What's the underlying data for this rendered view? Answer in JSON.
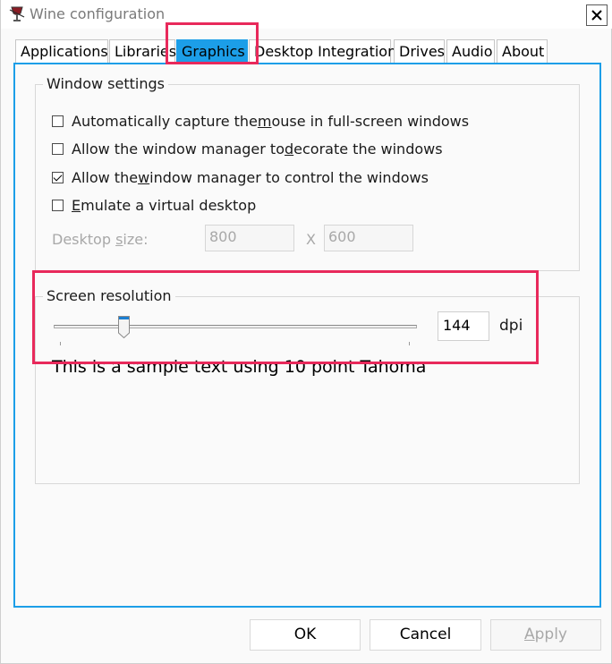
{
  "window": {
    "title": "Wine configuration",
    "close_label": "×"
  },
  "tabs": [
    {
      "label": "Applications"
    },
    {
      "label": "Libraries"
    },
    {
      "label": "Graphics",
      "active": true
    },
    {
      "label": "Desktop Integration"
    },
    {
      "label": "Drives"
    },
    {
      "label": "Audio"
    },
    {
      "label": "About"
    }
  ],
  "window_settings": {
    "legend": "Window settings",
    "options": [
      {
        "pre": "Automatically capture the ",
        "accel": "m",
        "post": "ouse in full-screen windows",
        "checked": false
      },
      {
        "pre": "Allow the window manager to ",
        "accel": "d",
        "post": "ecorate the windows",
        "checked": false
      },
      {
        "pre": "Allow the ",
        "accel": "w",
        "post": "indow manager to control the windows",
        "checked": true
      },
      {
        "pre": "",
        "accel": "E",
        "post": "mulate a virtual desktop",
        "checked": false
      }
    ],
    "desktop_size_label_pre": "Desktop ",
    "desktop_size_label_accel": "s",
    "desktop_size_label_post": "ize:",
    "width_value": "800",
    "separator": "X",
    "height_value": "600"
  },
  "screen_resolution": {
    "legend": "Screen resolution",
    "dpi_value": "144",
    "dpi_unit": "dpi",
    "slider_position_fraction": 0.19,
    "sample_text": "This is a sample text using 10 point Tahoma"
  },
  "buttons": {
    "ok": "OK",
    "cancel": "Cancel",
    "apply": "Apply"
  },
  "colors": {
    "accent": "#1c9ee8",
    "highlight": "#e8295b"
  }
}
